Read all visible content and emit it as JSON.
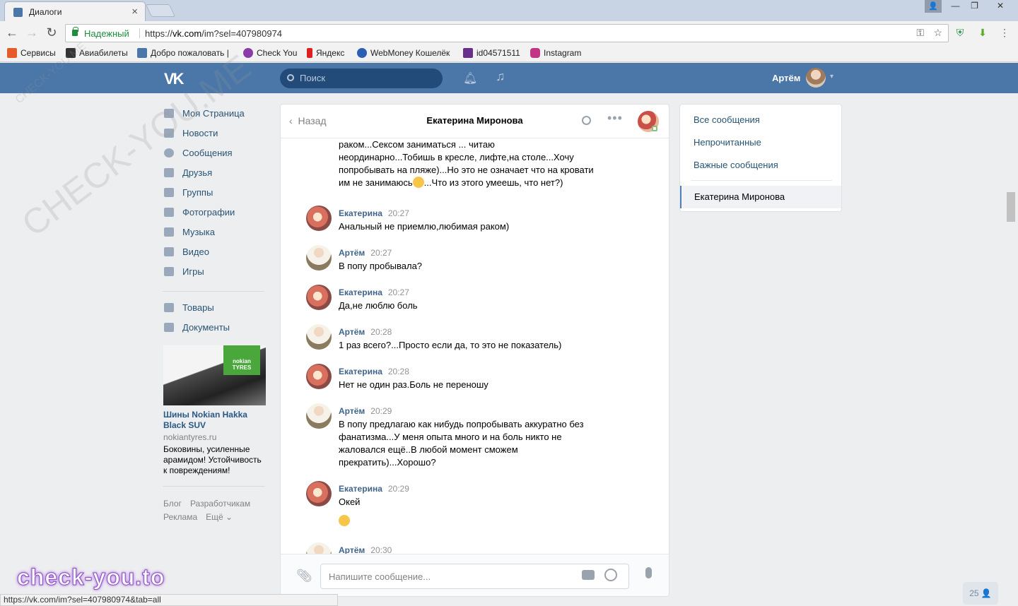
{
  "browser": {
    "tab_title": "Диалоги",
    "tab_close": "×",
    "window_user": "👤",
    "win_minimize": "—",
    "win_restore": "❐",
    "win_close": "✕",
    "secure_label": "Надежный",
    "url_scheme": "https://",
    "url_host": "vk.com",
    "url_path": "/im?sel=407980974",
    "status_url": "https://vk.com/im?sel=407980974&tab=all"
  },
  "bookmarks": [
    {
      "label": "Сервисы",
      "color": "#e55b2c"
    },
    {
      "label": "Авиабилеты",
      "color": "#333333"
    },
    {
      "label": "Добро пожаловать |",
      "color": "#4a76a8"
    },
    {
      "label": "Check You",
      "color": "#8b3aa8"
    },
    {
      "label": "Яндекс",
      "color": "#e02020"
    },
    {
      "label": "WebMoney Кошелёк",
      "color": "#2b5fb3"
    },
    {
      "label": "id04571511",
      "color": "#6a2f8a"
    },
    {
      "label": "Instagram",
      "color": "#c13584"
    }
  ],
  "vk": {
    "logo": "VK",
    "search_placeholder": "Поиск",
    "user_name": "Артём"
  },
  "left_menu": {
    "items": [
      "Моя Страница",
      "Новости",
      "Сообщения",
      "Друзья",
      "Группы",
      "Фотографии",
      "Музыка",
      "Видео",
      "Игры"
    ],
    "items2": [
      "Товары",
      "Документы"
    ]
  },
  "ad": {
    "logo_text": "nokian TYRES",
    "title": "Шины Nokian Hakka Black SUV",
    "domain": "nokiantyres.ru",
    "text": "Боковины, усиленные арамидом! Устойчивость к повреждениям!"
  },
  "footer": {
    "blog": "Блог",
    "devs": "Разработчикам",
    "ads": "Реклама",
    "more": "Ещё ⌄"
  },
  "chat": {
    "back": "Назад",
    "title": "Екатерина Миронова",
    "more": "•••",
    "first_message_lines": [
      "раком...Сексом заниматься ... читаю",
      "неординарно...Тобишь в кресле, лифте,на столе...Хочу",
      "попробывать на пляже)...Но это не означает что на кровати",
      "им не занимаюсь"
    ],
    "first_message_tail": "...Что из этого умеешь, что нет?)",
    "messages": [
      {
        "author": "Екатерина",
        "time": "20:27",
        "text": "Анальный не приемлю,любимая раком)",
        "who": "k"
      },
      {
        "author": "Артём",
        "time": "20:27",
        "text": "В попу пробывала?",
        "who": "a"
      },
      {
        "author": "Екатерина",
        "time": "20:27",
        "text": "Да,не люблю боль",
        "who": "k"
      },
      {
        "author": "Артём",
        "time": "20:28",
        "text": "1 раз всего?...Просто если да, то это не показатель)",
        "who": "a"
      },
      {
        "author": "Екатерина",
        "time": "20:28",
        "text": "Нет не один раз.Боль не переношу",
        "who": "k"
      },
      {
        "author": "Артём",
        "time": "20:29",
        "text": "В попу предлагаю как нибудь попробывать аккуратно без фанатизма...У меня опыта много и на боль никто не жаловался ещё..В любой момент сможем прекратить)...Хорошо?",
        "who": "a"
      },
      {
        "author": "Екатерина",
        "time": "20:29",
        "text": "Окей",
        "who": "k"
      },
      {
        "author": "Артём",
        "time": "20:30",
        "text": "",
        "who": "a"
      }
    ],
    "input_placeholder": "Напишите сообщение..."
  },
  "right_panel": {
    "all": "Все сообщения",
    "unread": "Непрочитанные",
    "important": "Важные сообщения",
    "active_dialog": "Екатерина Миронова"
  },
  "counter": "25 👤",
  "watermarks": {
    "diagonal": "CHECK-YOU.ME",
    "small": "CHECK-YOU.ME",
    "bottom": "check-you.to"
  }
}
